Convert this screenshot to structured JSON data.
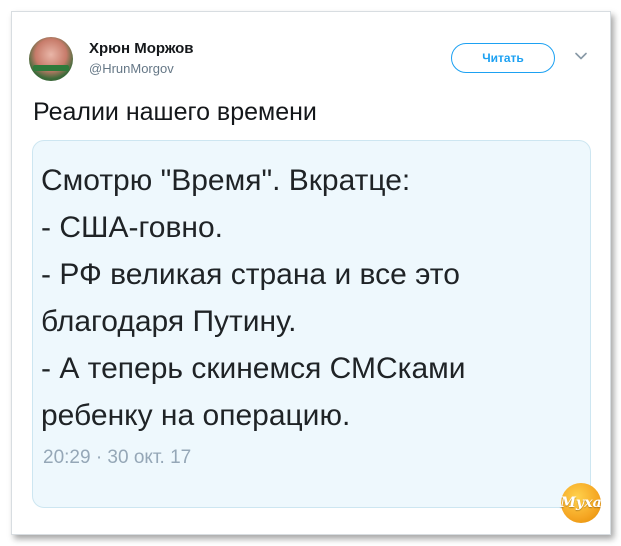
{
  "header": {
    "display_name": "Хрюн Моржов",
    "handle": "@HrunMorgov",
    "follow_label": "Читать"
  },
  "tweet": {
    "text": "Реалии нашего времени"
  },
  "quote": {
    "lines": [
      "Смотрю \"Время\". Вкратце:",
      "- США-говно.",
      "- РФ великая страна и все это",
      "благодаря Путину.",
      "- А теперь скинемся СМСками",
      "ребенку на операцию."
    ],
    "timestamp": "20:29 · 30 окт. 17"
  },
  "watermark": {
    "text": "Муха"
  },
  "colors": {
    "accent": "#1da1f2",
    "quote_bg": "#eef8fd",
    "logo": "#f5a623"
  }
}
